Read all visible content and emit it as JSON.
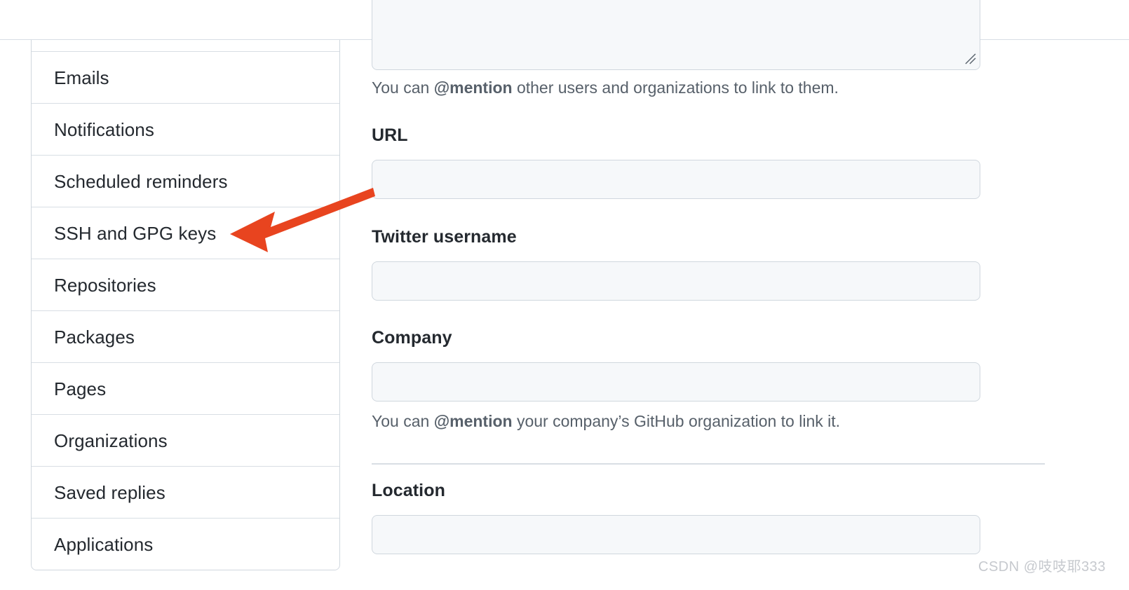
{
  "sidebar": {
    "items": [
      {
        "label": "Emails",
        "selected": false
      },
      {
        "label": "Notifications",
        "selected": false
      },
      {
        "label": "Scheduled reminders",
        "selected": false
      },
      {
        "label": "SSH and GPG keys",
        "selected": true
      },
      {
        "label": "Repositories",
        "selected": false
      },
      {
        "label": "Packages",
        "selected": false
      },
      {
        "label": "Pages",
        "selected": false
      },
      {
        "label": "Organizations",
        "selected": false
      },
      {
        "label": "Saved replies",
        "selected": false
      },
      {
        "label": "Applications",
        "selected": false
      }
    ]
  },
  "main": {
    "bio": {
      "value": "",
      "help_prefix": "You can ",
      "help_bold": "@mention",
      "help_suffix": " other users and organizations to link to them."
    },
    "url": {
      "label": "URL",
      "value": "",
      "placeholder": ""
    },
    "twitter": {
      "label": "Twitter username",
      "value": "",
      "placeholder": ""
    },
    "company": {
      "label": "Company",
      "value": "",
      "placeholder": "",
      "help_prefix": "You can ",
      "help_bold": "@mention",
      "help_suffix": " your company’s GitHub organization to link it."
    },
    "location": {
      "label": "Location",
      "value": "",
      "placeholder": ""
    }
  },
  "annotation": {
    "arrow_color": "#e8441f",
    "points_to": "SSH and GPG keys"
  },
  "watermark": {
    "text": "CSDN @吱吱耶333"
  },
  "colors": {
    "input_bg": "#f6f8fa",
    "input_border": "#d0d7de",
    "text_primary": "#24292f",
    "text_muted": "#57606a",
    "rule": "#d8dee4"
  }
}
